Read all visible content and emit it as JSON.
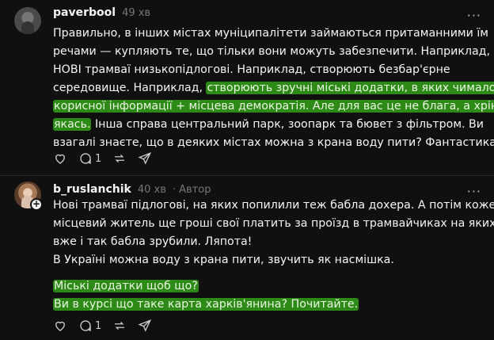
{
  "comments": [
    {
      "username": "paverbool",
      "time": "49 хв",
      "lines": [
        "Правильно, в інших містах муніципалітети займаються притаманними їм",
        "речами — купляють те, що тільки вони можуть забезпечити. Наприклад,",
        "НОВІ трамваї низькопідлогові. Наприклад, створюють безбар'єрне",
        "середовище. Наприклад,",
        "створюють зручні міські додатки, в яких чимало",
        "корисної інформації + місцева демократія. Але для вас це не блага, а хрінь",
        "якась.",
        " Інша справа центральний парк, зоопарк та бювет з фільтром. Ви",
        "взагалі знаєте, що в деяких містах можна з крана воду пити? Фантастика..."
      ],
      "reply_count": "1",
      "more_label": "···"
    },
    {
      "username": "b_ruslanchik",
      "time": "40 хв",
      "author_label": "· Автор",
      "lines": [
        "Нові трамваї підлогові, на яких попилили теж бабла дохера. А потім кожен",
        "місцевий житель ще гроші свої платить за проїзд в трамвайчиках на яких",
        "вже і так бабла зрубили. Ляпота!",
        "В Україні можна воду з крана пити, звучить як насмішка."
      ],
      "highlight_lines": [
        "Міські додатки щоб що?",
        "Ви в курсі що таке карта харків'янина? Почитайте."
      ],
      "reply_count": "1",
      "more_label": "···"
    }
  ],
  "colors": {
    "background": "#101010",
    "highlight": "#2e8a16",
    "text": "#f3f5f7",
    "muted": "#777777"
  }
}
